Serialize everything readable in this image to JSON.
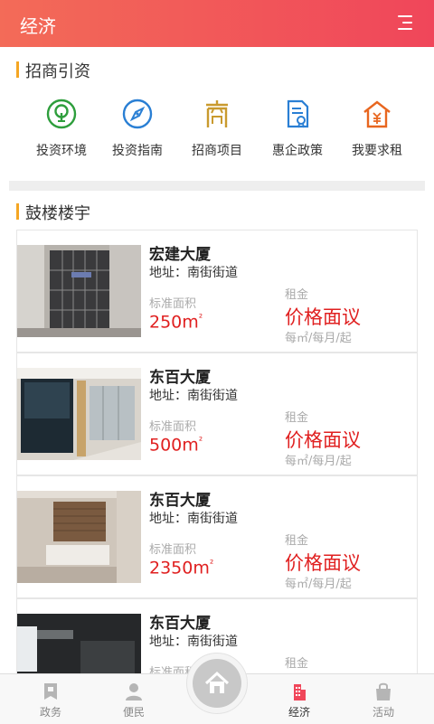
{
  "header": {
    "title": "经济",
    "menu_icon": "menu-icon"
  },
  "investment": {
    "title": "招商引资",
    "categories": [
      {
        "label": "投资环境",
        "icon": "tree-icon",
        "color": "#2e9e3c"
      },
      {
        "label": "投资指南",
        "icon": "compass-icon",
        "color": "#2a7fd4"
      },
      {
        "label": "招商项目",
        "icon": "shang-icon",
        "color": "#c99a2e"
      },
      {
        "label": "惠企政策",
        "icon": "document-icon",
        "color": "#2a7fd4"
      },
      {
        "label": "我要求租",
        "icon": "house-yuan-icon",
        "color": "#e8661f"
      }
    ]
  },
  "buildings": {
    "title": "鼓楼楼宇",
    "items": [
      {
        "name": "宏建大厦",
        "address": "地址：南街街道",
        "area_label": "标准面积",
        "area": "250m",
        "area_sup": "²",
        "rent_label": "租金",
        "rent": "价格面议",
        "rent_unit": "每㎡/每月/起"
      },
      {
        "name": "东百大厦",
        "address": "地址：南街街道",
        "area_label": "标准面积",
        "area": "500m",
        "area_sup": "²",
        "rent_label": "租金",
        "rent": "价格面议",
        "rent_unit": "每㎡/每月/起"
      },
      {
        "name": "东百大厦",
        "address": "地址：南街街道",
        "area_label": "标准面积",
        "area": "2350m",
        "area_sup": "²",
        "rent_label": "租金",
        "rent": "价格面议",
        "rent_unit": "每㎡/每月/起"
      },
      {
        "name": "东百大厦",
        "address": "地址：南街街道",
        "area_label": "标准面积",
        "rent_label": "租金"
      }
    ]
  },
  "tabbar": {
    "items": [
      {
        "label": "政务",
        "icon": "government-icon"
      },
      {
        "label": "便民",
        "icon": "person-icon"
      },
      {
        "label": "",
        "icon": "home-icon"
      },
      {
        "label": "经济",
        "icon": "building-icon",
        "active": true,
        "color": "#f0465a"
      },
      {
        "label": "活动",
        "icon": "bag-icon"
      }
    ]
  }
}
